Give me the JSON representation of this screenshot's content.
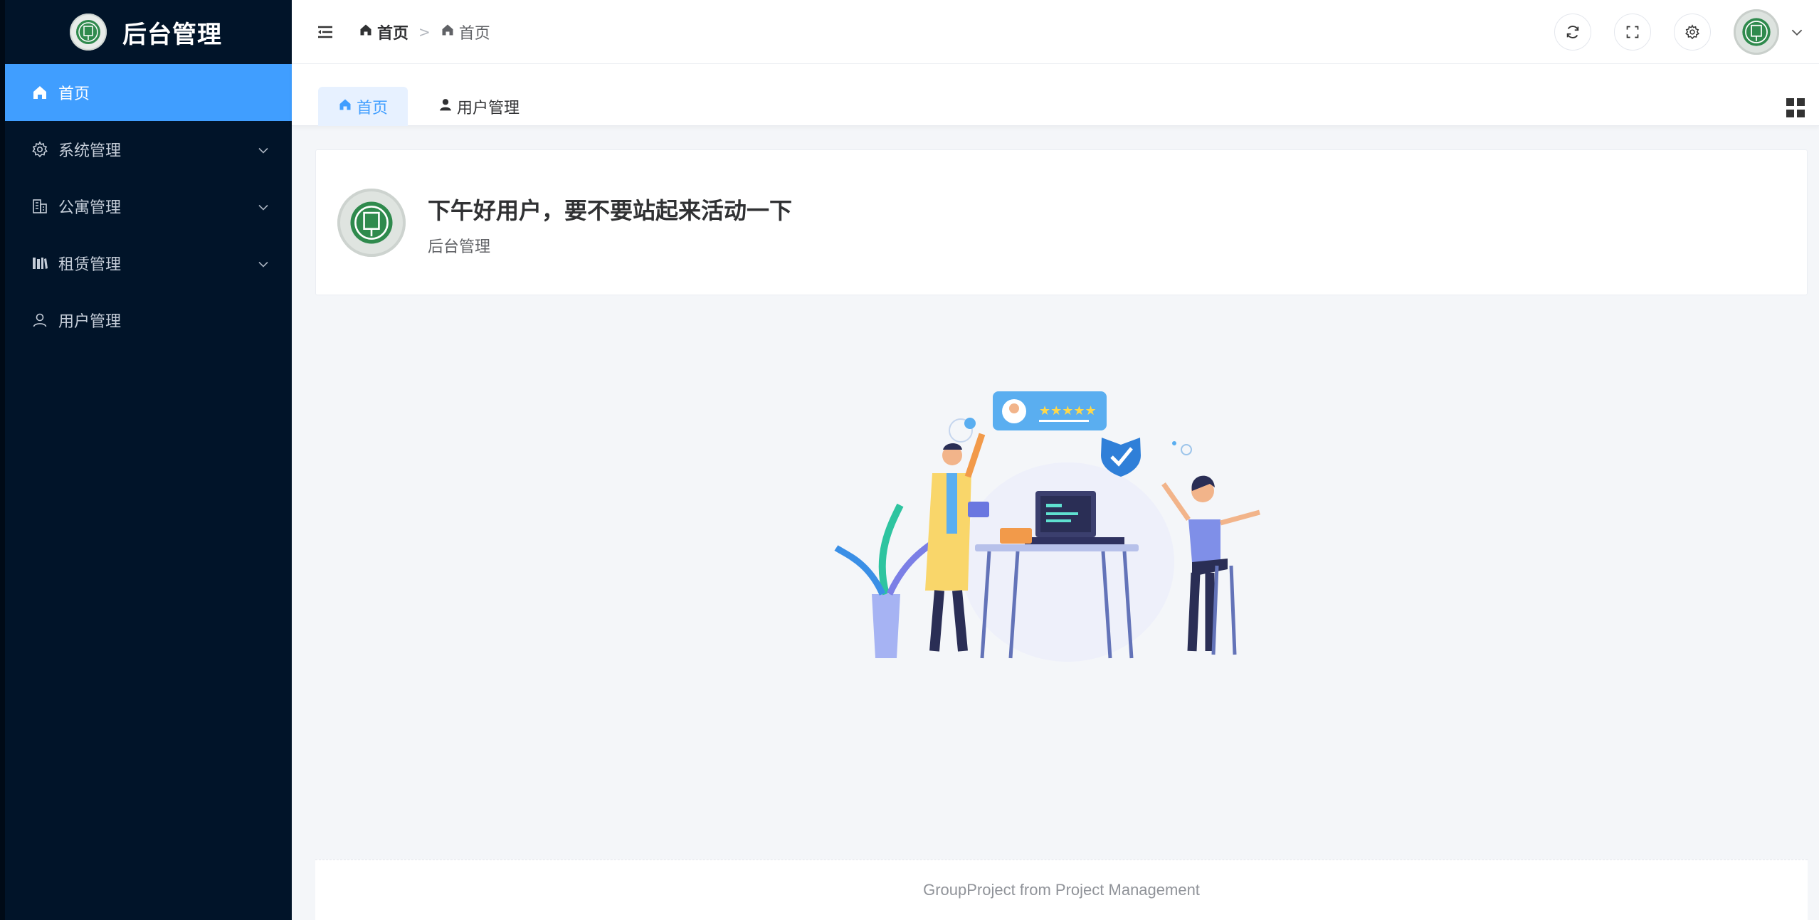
{
  "app": {
    "title": "后台管理"
  },
  "sidebar": {
    "items": [
      {
        "label": "首页",
        "icon": "home-icon",
        "active": true
      },
      {
        "label": "系统管理",
        "icon": "gear-icon",
        "expandable": true
      },
      {
        "label": "公寓管理",
        "icon": "building-icon",
        "expandable": true
      },
      {
        "label": "租赁管理",
        "icon": "books-icon",
        "expandable": true
      },
      {
        "label": "用户管理",
        "icon": "user-icon"
      }
    ]
  },
  "header": {
    "breadcrumb": [
      {
        "label": "首页",
        "icon": "home-icon"
      },
      {
        "label": "首页",
        "icon": "home-icon"
      }
    ],
    "actions": [
      "refresh-icon",
      "fullscreen-icon",
      "settings-icon",
      "avatar"
    ]
  },
  "tabs": [
    {
      "label": "首页",
      "icon": "home-icon",
      "active": true
    },
    {
      "label": "用户管理",
      "icon": "user-icon",
      "active": false
    }
  ],
  "welcome": {
    "greeting": "下午好用户，要不要站起来活动一下",
    "subtitle": "后台管理"
  },
  "footer": {
    "text": "GroupProject from Project Management"
  },
  "colors": {
    "sidebar_bg": "#011429",
    "accent": "#409eff",
    "logo_green": "#2f8a4d"
  }
}
